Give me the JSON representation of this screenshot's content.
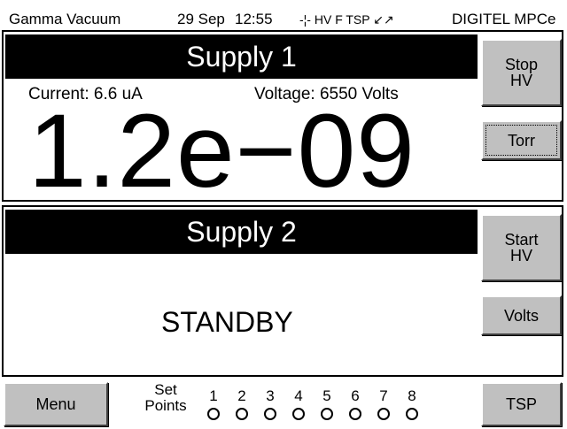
{
  "status": {
    "device_name": "Gamma Vacuum",
    "date": "29 Sep",
    "time": "12:55",
    "indicators": "-¦- HV F TSP ↙↗",
    "model": "DIGITEL MPCe"
  },
  "supply1": {
    "title": "Supply 1",
    "current_label": "Current: 6.6 uA",
    "voltage_label": "Voltage: 6550 Volts",
    "pressure": "1.2e−09",
    "stop_button": "Stop\nHV",
    "units_button": "Torr"
  },
  "supply2": {
    "title": "Supply 2",
    "state": "STANDBY",
    "start_button": "Start\nHV",
    "units_button": "Volts"
  },
  "bottom": {
    "menu_button": "Menu",
    "setpoints_label": "Set\nPoints",
    "setpoints": [
      "1",
      "2",
      "3",
      "4",
      "5",
      "6",
      "7",
      "8"
    ],
    "tsp_button": "TSP"
  },
  "colors": {
    "title_bar": "#000000",
    "button_face": "#c0c0c0",
    "background": "#ffffff"
  }
}
